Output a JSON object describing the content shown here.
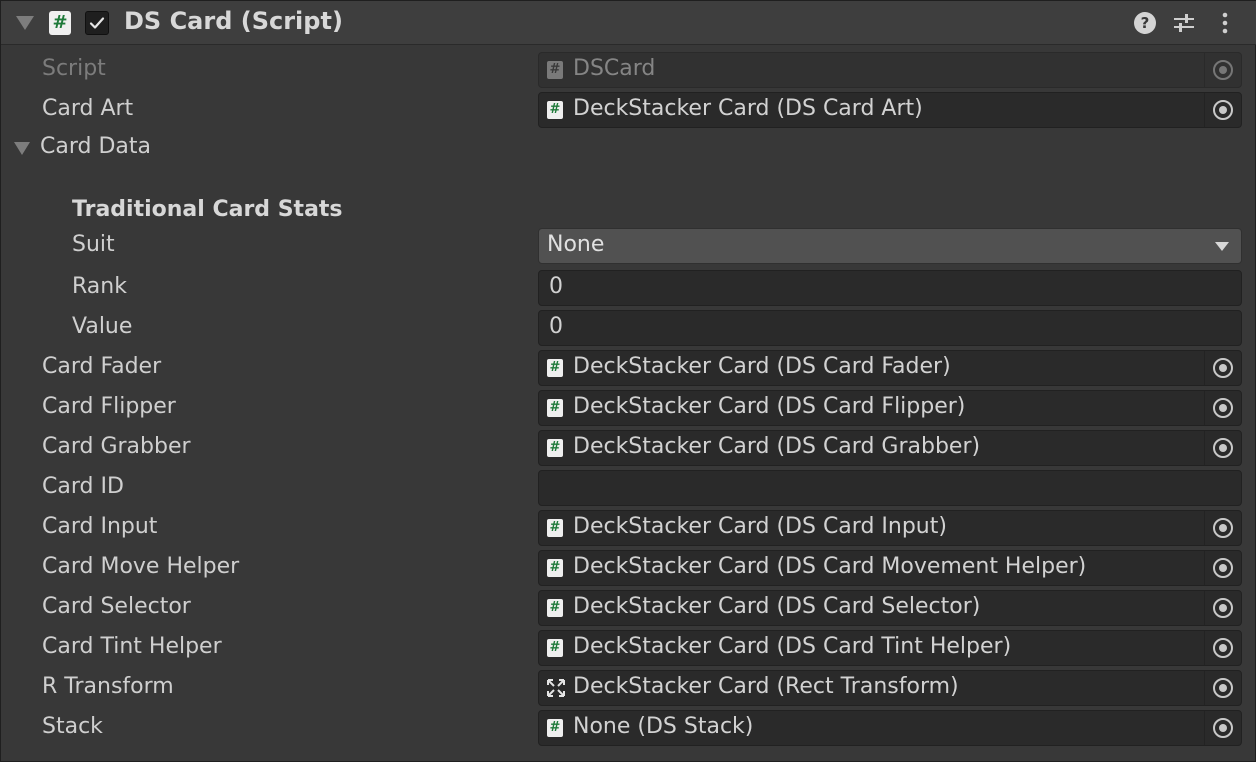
{
  "header": {
    "title": "DS Card (Script)",
    "enabled": true,
    "script_icon": "#",
    "help_glyph": "?"
  },
  "fields": {
    "script": {
      "label": "Script",
      "value": "DSCard"
    },
    "card_art": {
      "label": "Card Art",
      "value": "DeckStacker Card (DS Card Art)"
    },
    "card_data": {
      "label": "Card Data",
      "section": "Traditional Card Stats",
      "suit": {
        "label": "Suit",
        "value": "None"
      },
      "rank": {
        "label": "Rank",
        "value": "0"
      },
      "value": {
        "label": "Value",
        "value": "0"
      }
    },
    "card_fader": {
      "label": "Card Fader",
      "value": "DeckStacker Card (DS Card Fader)"
    },
    "card_flipper": {
      "label": "Card Flipper",
      "value": "DeckStacker Card (DS Card Flipper)"
    },
    "card_grabber": {
      "label": "Card Grabber",
      "value": "DeckStacker Card (DS Card Grabber)"
    },
    "card_id": {
      "label": "Card ID",
      "value": ""
    },
    "card_input": {
      "label": "Card Input",
      "value": "DeckStacker Card (DS Card Input)"
    },
    "card_move_helper": {
      "label": "Card Move Helper",
      "value": "DeckStacker Card (DS Card Movement Helper)"
    },
    "card_selector": {
      "label": "Card Selector",
      "value": "DeckStacker Card (DS Card Selector)"
    },
    "card_tint_helper": {
      "label": "Card Tint Helper",
      "value": "DeckStacker Card (DS Card Tint Helper)"
    },
    "r_transform": {
      "label": "R Transform",
      "value": "DeckStacker Card (Rect Transform)"
    },
    "stack": {
      "label": "Stack",
      "value": "None (DS Stack)"
    }
  },
  "colors": {
    "panel_bg": "#383838",
    "header_bg": "#3e3e3e",
    "field_bg": "#2a2a2a",
    "dropdown_bg": "#515151",
    "script_icon_green": "#1f7a3a"
  }
}
